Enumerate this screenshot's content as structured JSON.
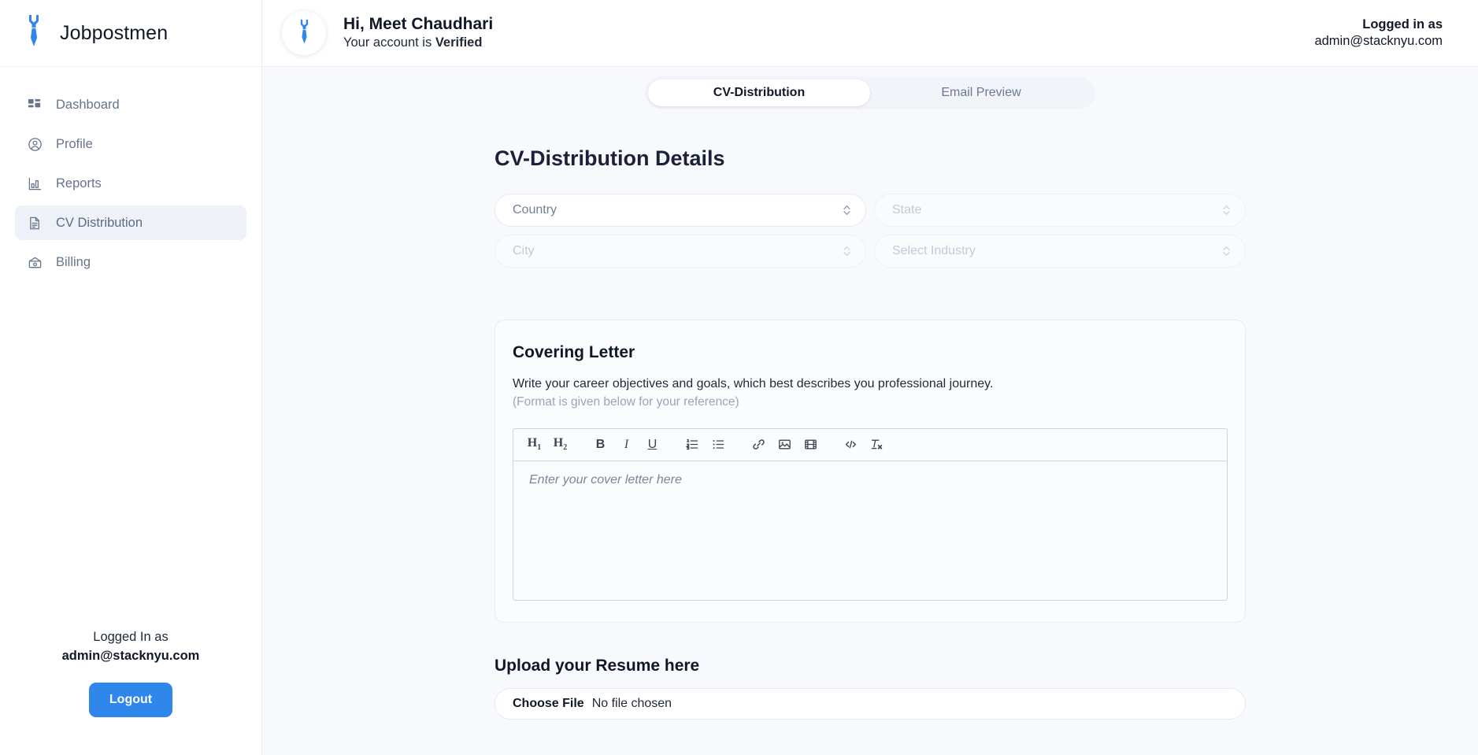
{
  "brand": {
    "name": "Jobpostmen",
    "logo_icon": "necktie-icon",
    "accent_color": "#2f86eb"
  },
  "sidebar": {
    "items": [
      {
        "label": "Dashboard",
        "icon": "grid-icon",
        "active": false
      },
      {
        "label": "Profile",
        "icon": "user-circle-icon",
        "active": false
      },
      {
        "label": "Reports",
        "icon": "bar-chart-icon",
        "active": false
      },
      {
        "label": "CV Distribution",
        "icon": "document-icon",
        "active": true
      },
      {
        "label": "Billing",
        "icon": "wallet-icon",
        "active": false
      }
    ],
    "footer": {
      "logged_label": "Logged In as",
      "email": "admin@stacknyu.com",
      "logout_label": "Logout"
    }
  },
  "topbar": {
    "avatar_icon": "necktie-avatar-icon",
    "greeting": "Hi, Meet Chaudhari",
    "status_prefix": "Your account is ",
    "status_value": "Verified",
    "logged_in_label": "Logged in as",
    "logged_in_email": "admin@stacknyu.com"
  },
  "tabs": [
    {
      "label": "CV-Distribution",
      "active": true
    },
    {
      "label": "Email Preview",
      "active": false
    }
  ],
  "main": {
    "page_title": "CV-Distribution Details",
    "selects": [
      {
        "placeholder": "Country",
        "value": "",
        "disabled": false,
        "name": "country"
      },
      {
        "placeholder": "State",
        "value": "",
        "disabled": true,
        "name": "state"
      },
      {
        "placeholder": "City",
        "value": "",
        "disabled": true,
        "name": "city"
      },
      {
        "placeholder": "Select Industry",
        "value": "",
        "disabled": true,
        "name": "industry"
      }
    ],
    "covering_letter": {
      "title": "Covering Letter",
      "description": "Write your career objectives and goals, which best describes you professional journey.",
      "note": "(Format is given below for your reference)",
      "editor_placeholder": "Enter your cover letter here",
      "toolbar": [
        {
          "icon": "heading-1-icon",
          "label": "H",
          "sub": "1"
        },
        {
          "icon": "heading-2-icon",
          "label": "H",
          "sub": "2"
        },
        {
          "icon": "bold-icon",
          "label": "B"
        },
        {
          "icon": "italic-icon",
          "label": "I"
        },
        {
          "icon": "underline-icon",
          "label": "U"
        },
        {
          "icon": "ordered-list-icon",
          "label": ""
        },
        {
          "icon": "unordered-list-icon",
          "label": ""
        },
        {
          "icon": "link-icon",
          "label": ""
        },
        {
          "icon": "image-icon",
          "label": ""
        },
        {
          "icon": "video-icon",
          "label": ""
        },
        {
          "icon": "code-icon",
          "label": ""
        },
        {
          "icon": "clear-format-icon",
          "label": ""
        }
      ]
    },
    "upload": {
      "title": "Upload your Resume here",
      "choose_label": "Choose File",
      "file_status": "No file chosen"
    }
  }
}
